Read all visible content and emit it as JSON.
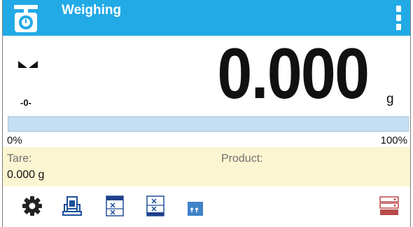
{
  "header": {
    "title": "Weighing",
    "app_icon": "scale-icon",
    "menu_icon": "vertical-dots-icon",
    "accent_color": "#22aae6"
  },
  "display": {
    "value": "0.000",
    "unit": "g",
    "stable_icon": "stability-indicator-icon",
    "zero_indicator": "-0-"
  },
  "bargraph": {
    "min_label": "0%",
    "max_label": "100%",
    "fill_fraction": 0
  },
  "info": {
    "tare_label": "Tare:",
    "tare_value": "0.000 g",
    "product_label": "Product:"
  },
  "toolbar": {
    "buttons": [
      {
        "icon": "settings-gear-icon"
      },
      {
        "icon": "tare-icon"
      },
      {
        "icon": "database-list-icon"
      },
      {
        "icon": "database-select-icon"
      },
      {
        "icon": "statistics-icon"
      },
      {
        "icon": "database-icon"
      }
    ]
  }
}
